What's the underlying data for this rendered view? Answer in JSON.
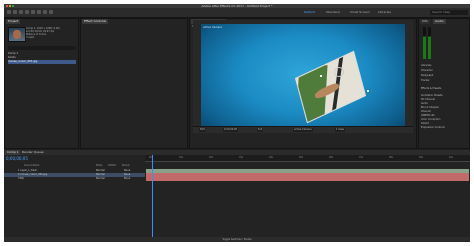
{
  "window": {
    "title": "Adobe After Effects CC 2017 - Untitled Project *"
  },
  "toolbar": {
    "workspaces": [
      "Default",
      "Standard",
      "Small Screen",
      "Libraries"
    ],
    "active_workspace": "Default",
    "search_placeholder": "Search Help"
  },
  "project": {
    "tab": "Project",
    "meta": [
      "Comp 1, 1920 x 1080 (1.00)",
      "Δ 0;00;10;00, 29.97 fps",
      "Millions of Colors",
      "3 used"
    ],
    "search_placeholder": "",
    "rows": [
      "Comp 1",
      "Solids",
      "mouse_cursor_001.jpg"
    ],
    "selected_row": 2
  },
  "effects_panel": {
    "tab": "Effect Controls"
  },
  "composition": {
    "tab": "Composition Comp 1",
    "header": "Comp 1 • Layer_1_track",
    "view_label": "Active Camera",
    "bottom_controls": [
      "50%",
      "0:00:00:05",
      "Full",
      "Active Camera",
      "1 View"
    ]
  },
  "right_panel": {
    "tabs": [
      "Info",
      "Audio"
    ],
    "items": [
      "Libraries",
      "Character",
      "Paragraph",
      "Tracker",
      "Effects & Presets",
      "Animation Presets",
      "3D Channel",
      "Audio",
      "Blur & Sharpen",
      "Channel",
      "CINEMA 4D",
      "Color Correction",
      "Distort",
      "Expression Controls"
    ]
  },
  "timeline": {
    "tab": "Comp 1",
    "render_tab": "Render Queue",
    "timecode": "0;00;00;05",
    "ticks": [
      "00s",
      "01s",
      "02s",
      "03s",
      "04s",
      "05s",
      "06s",
      "07s",
      "08s",
      "09s",
      "10s"
    ],
    "columns": [
      "Source Name",
      "Mode",
      "TrkMat",
      "Parent"
    ],
    "layers": [
      {
        "name": "1  Layer_1_track",
        "mode": "Normal",
        "parent": "None"
      },
      {
        "name": "2  mouse_cursor_001.jpg",
        "mode": "Normal",
        "parent": "None"
      },
      {
        "name": "3  BG",
        "mode": "Normal",
        "parent": "None"
      }
    ],
    "footer": "Toggle Switches / Modes"
  }
}
